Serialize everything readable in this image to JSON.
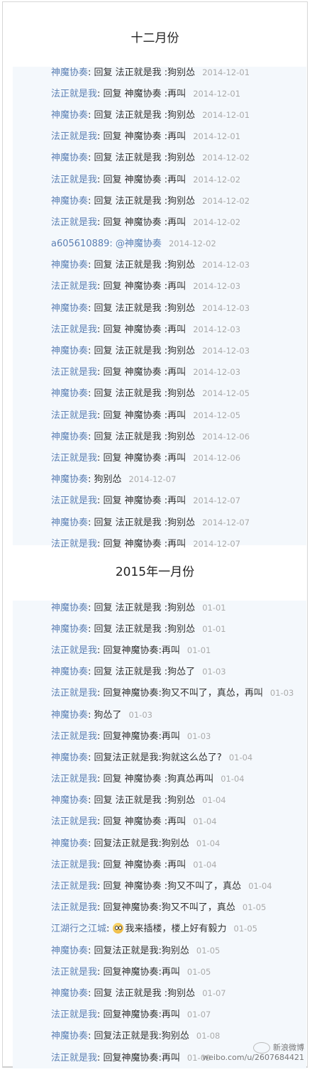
{
  "sections": [
    {
      "title": "十二月份",
      "rows": [
        {
          "user": "神魔协奏",
          "text": "回复 法正就是我 :狗别怂",
          "date": "2014-12-01"
        },
        {
          "user": "法正就是我",
          "text": "回复 神魔协奏 :再叫",
          "date": "2014-12-01"
        },
        {
          "user": "神魔协奏",
          "text": "回复 法正就是我 :狗别怂",
          "date": "2014-12-01"
        },
        {
          "user": "法正就是我",
          "text": "回复 神魔协奏 :再叫",
          "date": "2014-12-01"
        },
        {
          "user": "神魔协奏",
          "text": "回复 法正就是我 :狗别怂",
          "date": "2014-12-02"
        },
        {
          "user": "法正就是我",
          "text": "回复 神魔协奏 :再叫",
          "date": "2014-12-02"
        },
        {
          "user": "神魔协奏",
          "text": "回复 法正就是我 :狗别怂",
          "date": "2014-12-02"
        },
        {
          "user": "法正就是我",
          "text": "回复 神魔协奏 :再叫",
          "date": "2014-12-02"
        },
        {
          "user": "a605610889",
          "text": "@神魔协奏",
          "date": "2014-12-02",
          "all_blue": true
        },
        {
          "user": "神魔协奏",
          "text": "回复 法正就是我 :狗别怂",
          "date": "2014-12-03"
        },
        {
          "user": "法正就是我",
          "text": "回复 神魔协奏 :再叫",
          "date": "2014-12-03"
        },
        {
          "user": "神魔协奏",
          "text": "回复 法正就是我 :狗别怂",
          "date": "2014-12-03"
        },
        {
          "user": "法正就是我",
          "text": "回复 神魔协奏 :再叫",
          "date": "2014-12-03"
        },
        {
          "user": "神魔协奏",
          "text": "回复 法正就是我 :狗别怂",
          "date": "2014-12-03"
        },
        {
          "user": "法正就是我",
          "text": "回复 神魔协奏 :再叫",
          "date": "2014-12-03"
        },
        {
          "user": "神魔协奏",
          "text": "回复 法正就是我 :狗别怂",
          "date": "2014-12-05"
        },
        {
          "user": "法正就是我",
          "text": "回复 神魔协奏 :再叫",
          "date": "2014-12-05"
        },
        {
          "user": "神魔协奏",
          "text": "回复 法正就是我 :狗别怂",
          "date": "2014-12-06"
        },
        {
          "user": "法正就是我",
          "text": "回复 神魔协奏 :再叫",
          "date": "2014-12-06"
        },
        {
          "user": "神魔协奏",
          "text": "狗别怂",
          "date": "2014-12-07"
        },
        {
          "user": "法正就是我",
          "text": "回复 神魔协奏 :再叫",
          "date": "2014-12-07"
        },
        {
          "user": "神魔协奏",
          "text": "回复 法正就是我 :狗别怂",
          "date": "2014-12-07"
        },
        {
          "user": "法正就是我",
          "text": "回复 神魔协奏 :再叫",
          "date": "2014-12-07"
        }
      ]
    },
    {
      "title": "2015年一月份",
      "rows": [
        {
          "user": "神魔协奏",
          "text": "回复 法正就是我 :狗别怂",
          "date": "01-01"
        },
        {
          "user": "神魔协奏",
          "text": "回复 法正就是我 :狗别怂",
          "date": "01-01"
        },
        {
          "user": "法正就是我",
          "text": "回复神魔协奏:再叫",
          "date": "01-01"
        },
        {
          "user": "神魔协奏",
          "text": "回复 法正就是我 :狗怂了",
          "date": "01-03"
        },
        {
          "user": "法正就是我",
          "text": "回复神魔协奏:狗又不叫了，真怂，再叫",
          "date": "01-03"
        },
        {
          "user": "神魔协奏",
          "text": "狗怂了",
          "date": "01-03"
        },
        {
          "user": "法正就是我",
          "text": "回复神魔协奏:再叫",
          "date": "01-03"
        },
        {
          "user": "神魔协奏",
          "text": "回复法正就是我:狗就这么怂了?",
          "date": "01-04"
        },
        {
          "user": "法正就是我",
          "text": "回复 神魔协奏 :狗真怂再叫",
          "date": "01-04"
        },
        {
          "user": "神魔协奏",
          "text": "回复 法正就是我 :狗别怂",
          "date": "01-04"
        },
        {
          "user": "法正就是我",
          "text": "回复 神魔协奏 :再叫",
          "date": "01-04"
        },
        {
          "user": "神魔协奏",
          "text": "回复法正就是我:狗别怂",
          "date": "01-04"
        },
        {
          "user": "法正就是我",
          "text": "回复 神魔协奏 :再叫",
          "date": "01-04"
        },
        {
          "user": "法正就是我",
          "text": "回复 神魔协奏 :狗又不叫了，真怂",
          "date": "01-04"
        },
        {
          "user": "法正就是我",
          "text": "回复神魔协奏:狗又不叫了，真怂",
          "date": "01-05"
        },
        {
          "user": "江湖行之江城",
          "text": "我来插楼，楼上好有毅力",
          "date": "01-05",
          "emoji": "smiley-emoji"
        },
        {
          "user": "神魔协奏",
          "text": "回复法正就是我:狗别怂",
          "date": "01-05"
        },
        {
          "user": "法正就是我",
          "text": "回复神魔协奏:再叫",
          "date": "01-05"
        },
        {
          "user": "神魔协奏",
          "text": "回复 法正就是我 :狗别怂",
          "date": "01-07"
        },
        {
          "user": "法正就是我",
          "text": "回复神魔协奏:再叫",
          "date": "01-07"
        },
        {
          "user": "神魔协奏",
          "text": "回复法正就是我:狗别怂",
          "date": "01-08"
        },
        {
          "user": "法正就是我",
          "text": "回复神魔协奏:再叫",
          "date": "01-09"
        }
      ]
    }
  ],
  "separator": ": ",
  "watermark": {
    "name": "新浪微博",
    "url": "weibo.com/u/2607684421"
  },
  "colors": {
    "user": "#5b7fb3",
    "text": "#333333",
    "date": "#aaaaaa",
    "box_bg": "#f4f8fc"
  }
}
